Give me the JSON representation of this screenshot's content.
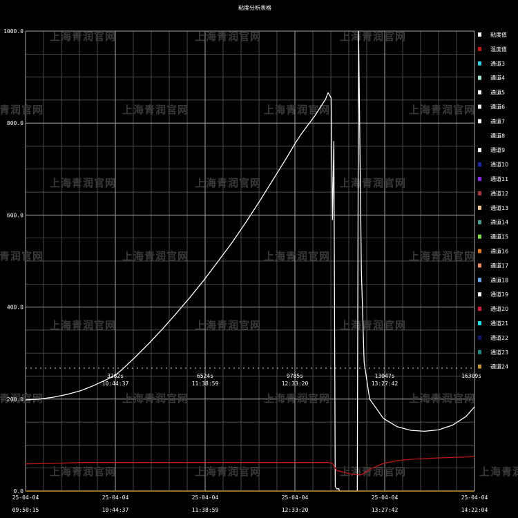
{
  "chart_data": {
    "type": "line",
    "title": "粘度分析表格",
    "ylim": [
      0,
      1000
    ],
    "yticks": [
      "1000.0",
      "800.0",
      "600.0",
      "400.0",
      "200.0",
      "0.0"
    ],
    "xticks": [
      {
        "date": "25-04-04",
        "time": "09:50:15"
      },
      {
        "date": "25-04-04",
        "time": "10:44:37"
      },
      {
        "date": "25-04-04",
        "time": "11:38:59"
      },
      {
        "date": "25-04-04",
        "time": "12:33:20"
      },
      {
        "date": "25-04-04",
        "time": "13:27:42"
      },
      {
        "date": "25-04-04",
        "time": "14:22:04"
      }
    ],
    "elapsed_ticks": [
      {
        "seconds": "3262s",
        "time": "10:44:37"
      },
      {
        "seconds": "6524s",
        "time": "11:38:59"
      },
      {
        "seconds": "9785s",
        "time": "12:33:20"
      },
      {
        "seconds": "13047s",
        "time": "13:27:42"
      },
      {
        "seconds": "16309s",
        "time": ""
      }
    ],
    "x_unit": "seconds since 09:50:15",
    "x_range": [
      0,
      16309
    ],
    "grid": true,
    "legend_position": "right",
    "series": [
      {
        "name": "粘度值",
        "color": "#ffffff",
        "x": [
          0,
          500,
          1000,
          1500,
          2000,
          2500,
          3000,
          3262,
          3500,
          4000,
          4500,
          5000,
          5500,
          6000,
          6524,
          7000,
          7500,
          8000,
          8500,
          9000,
          9500,
          9785,
          10000,
          10500,
          10900,
          10990,
          11100,
          11150,
          11200,
          11250,
          11300,
          11350,
          11380,
          11400,
          11700,
          12050,
          12100,
          12200,
          12300,
          12500,
          13000,
          13500,
          14000,
          14500,
          15000,
          15500,
          16000,
          16309
        ],
        "y": [
          198,
          200,
          204,
          210,
          218,
          230,
          244,
          252,
          264,
          292,
          322,
          354,
          388,
          423,
          462,
          500,
          540,
          584,
          630,
          678,
          726,
          755,
          775,
          815,
          852,
          866,
          855,
          590,
          760,
          10,
          5,
          5,
          5,
          0,
          0,
          0,
          1000,
          480,
          280,
          200,
          158,
          140,
          132,
          130,
          133,
          143,
          162,
          183
        ]
      },
      {
        "name": "温度值",
        "color": "#c01818",
        "x": [
          0,
          1000,
          2000,
          3000,
          4000,
          5000,
          6000,
          7000,
          8000,
          9000,
          10000,
          11000,
          11150,
          11300,
          11600,
          11900,
          12200,
          12500,
          13000,
          13500,
          14000,
          15000,
          16000,
          16309
        ],
        "y": [
          59,
          60,
          62,
          62,
          62,
          62,
          62,
          62,
          62,
          62,
          62,
          62,
          60,
          45,
          40,
          36,
          35,
          47,
          60,
          66,
          69,
          72,
          74,
          75
        ]
      },
      {
        "name": "通道24",
        "color": "#c8943a",
        "x": [
          0,
          16309
        ],
        "y": [
          0,
          0
        ]
      }
    ],
    "legend": [
      {
        "name": "粘度值",
        "color": "#ffffff"
      },
      {
        "name": "温度值",
        "color": "#c01818"
      },
      {
        "name": "通道3",
        "color": "#2fd0e0"
      },
      {
        "name": "通道4",
        "color": "#a8ead0"
      },
      {
        "name": "通道5",
        "color": "#ffffff"
      },
      {
        "name": "通道6",
        "color": "#f0f0f0"
      },
      {
        "name": "通道7",
        "color": "#ffffff"
      },
      {
        "name": "通道8",
        "color": "#000000"
      },
      {
        "name": "通道9",
        "color": "#ffffff"
      },
      {
        "name": "通道10",
        "color": "#1a2aa8"
      },
      {
        "name": "通道11",
        "color": "#8a2be2"
      },
      {
        "name": "通道12",
        "color": "#a83a3a"
      },
      {
        "name": "通道13",
        "color": "#f5c89a"
      },
      {
        "name": "通道14",
        "color": "#4aa09a"
      },
      {
        "name": "通道15",
        "color": "#7ee04a"
      },
      {
        "name": "通道16",
        "color": "#e07a20"
      },
      {
        "name": "通道17",
        "color": "#f08a60"
      },
      {
        "name": "通道18",
        "color": "#6aa8f0"
      },
      {
        "name": "通道19",
        "color": "#ffffff"
      },
      {
        "name": "通道20",
        "color": "#d02040"
      },
      {
        "name": "通道21",
        "color": "#20e0e8"
      },
      {
        "name": "通道22",
        "color": "#101870"
      },
      {
        "name": "通道23",
        "color": "#208a8a"
      },
      {
        "name": "通道24",
        "color": "#c8943a"
      }
    ]
  },
  "watermark": "上海青润官网"
}
